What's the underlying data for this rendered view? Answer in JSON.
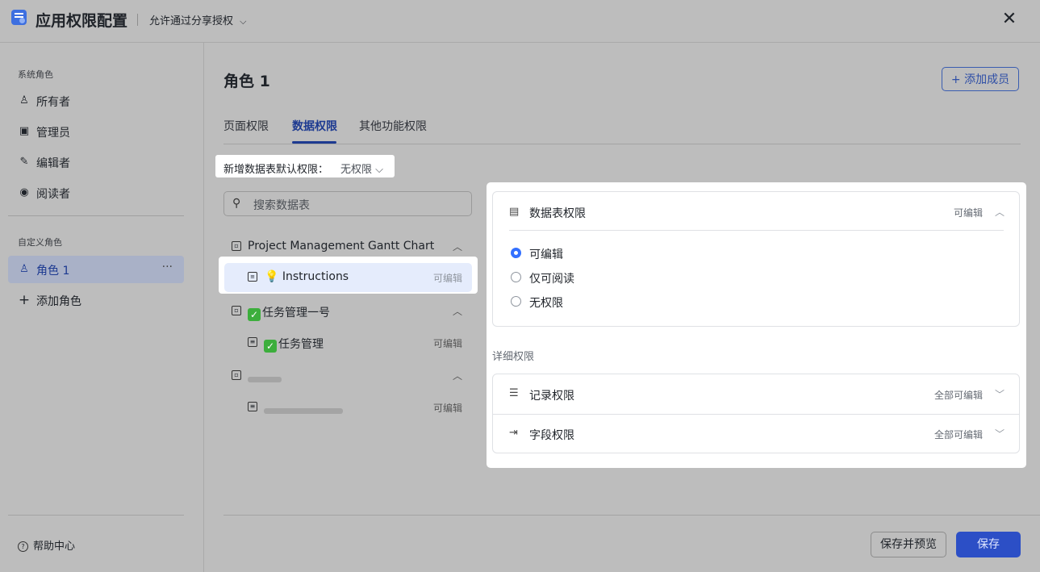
{
  "header": {
    "title": "应用权限配置",
    "share_option": "允许通过分享授权",
    "share_chevron": "⌵",
    "close_glyph": "✕"
  },
  "sidebar": {
    "system_roles_label": "系统角色",
    "system_roles": [
      {
        "label": "所有者",
        "icon": "users-icon",
        "glyph": "♙"
      },
      {
        "label": "管理员",
        "icon": "admin-icon",
        "glyph": "▣"
      },
      {
        "label": "编辑者",
        "icon": "edit-icon",
        "glyph": "✎"
      },
      {
        "label": "阅读者",
        "icon": "eye-icon",
        "glyph": "◉"
      }
    ],
    "custom_roles_label": "自定义角色",
    "custom_roles": [
      {
        "label": "角色 1",
        "icon": "user-icon",
        "glyph": "♙",
        "more": "···",
        "active": true
      }
    ],
    "add_role": {
      "label": "添加角色",
      "glyph": "+"
    },
    "help": {
      "label": "帮助中心",
      "glyph": "?"
    }
  },
  "main": {
    "role_title": "角色 1",
    "add_member": "+ 添加成员",
    "tabs": [
      {
        "label": "页面权限",
        "active": false
      },
      {
        "label": "数据权限",
        "active": true
      },
      {
        "label": "其他功能权限",
        "active": false
      }
    ],
    "default_permission": {
      "label": "新增数据表默认权限：",
      "value": "无权限 ⌵"
    },
    "search": {
      "placeholder": "搜索数据表",
      "glyph": "⚲"
    },
    "tree": [
      {
        "type": "base",
        "label": "Project Management Gantt Chart",
        "chevron": "︿"
      },
      {
        "type": "table",
        "label": "💡 Instructions",
        "perm": "可编辑",
        "selected": true
      },
      {
        "type": "base",
        "check": "✓",
        "label": "任务管理一号",
        "chevron": "︿"
      },
      {
        "type": "table",
        "check": "✓",
        "label": "任务管理",
        "perm": "可编辑"
      },
      {
        "type": "base",
        "blurred": true,
        "chevron": "︿"
      },
      {
        "type": "table",
        "blurred": true,
        "perm": "可编辑"
      }
    ]
  },
  "panel": {
    "table_perm": {
      "title": "数据表权限",
      "value": "可编辑",
      "chevron": "︿"
    },
    "options": [
      {
        "label": "可编辑",
        "checked": true
      },
      {
        "label": "仅可阅读",
        "checked": false
      },
      {
        "label": "无权限",
        "checked": false
      }
    ],
    "detail_label": "详细权限",
    "record_perm": {
      "title": "记录权限",
      "value": "全部可编辑",
      "chevron": "﹀",
      "glyph": "☰"
    },
    "field_perm": {
      "title": "字段权限",
      "value": "全部可编辑",
      "chevron": "﹀",
      "glyph": "⇥"
    }
  },
  "footer": {
    "save_preview": "保存并预览",
    "save": "保存"
  },
  "colors": {
    "accent": "#3370ff",
    "primary_button": "#2c4fc6",
    "overlay": "#bdbdbd"
  }
}
